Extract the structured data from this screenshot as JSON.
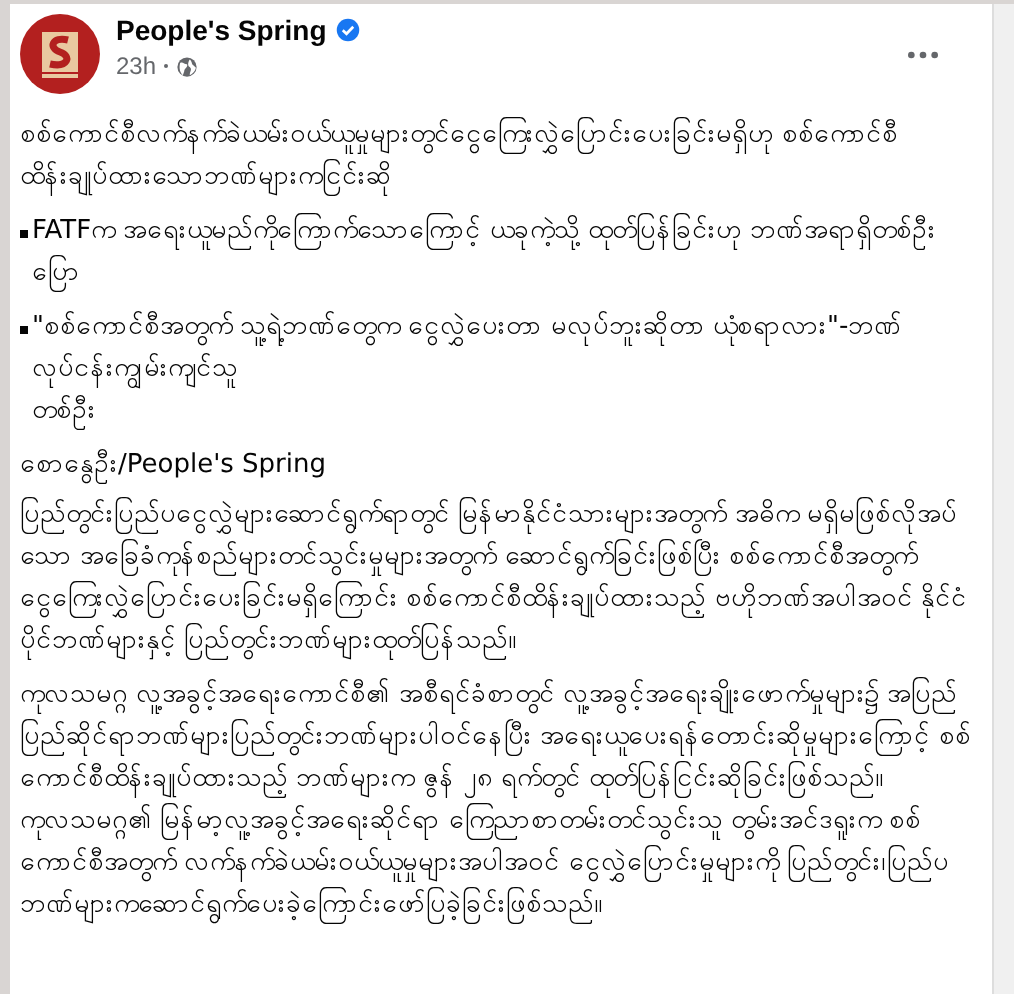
{
  "post": {
    "author": "People's Spring",
    "verified": true,
    "time": "23h",
    "paragraphs": [
      {
        "kind": "text",
        "text": "စစ်ကောင်စီလက်နက်ခဲယမ်းဝယ်ယူမှုများတွင်ငွေကြေးလွှဲပြောင်းပေးခြင်းမရှိဟု စစ်ကောင်စီထိန်းချုပ်ထားသောဘဏ်များကငြင်းဆို"
      },
      {
        "kind": "bullet",
        "text": "FATFက အရေးယူမည်ကိုကြောက်သောကြောင့် ယခုကဲ့သို့ ထုတ်ပြန်ခြင်းဟု ဘဏ်အရာရှိတစ်ဦးပြော"
      },
      {
        "kind": "bullet",
        "text": "\"စစ်ကောင်စီအတွက် သူ့ရဲ့ဘဏ်တွေက ငွေလွှဲပေးတာ မလုပ်ဘူးဆိုတာ ယုံစရာလား\"-ဘဏ်လုပ်ငန်းကျွမ်းကျင်သူ\nတစ်ဦး"
      },
      {
        "kind": "byline",
        "text": "စောနွေဦး/People's Spring"
      },
      {
        "kind": "text",
        "text": "ပြည်တွင်းပြည်ပငွေလွှဲများဆောင်ရွက်ရာတွင် မြန်မာနိုင်ငံသားများအတွက် အဓိက မရှိမဖြစ်လိုအပ်သော အခြေခံကုန်စည်များတင်သွင်းမှုများအတွက် ဆောင်ရွက်ခြင်းဖြစ်ပြီး စစ်ကောင်စီအတွက် ငွေကြေးလွှဲပြောင်းပေးခြင်းမရှိကြောင်း စစ်ကောင်စီထိန်းချုပ်ထားသည့် ဗဟိုဘဏ်အပါအဝင် နိုင်ငံပိုင်ဘဏ်များနှင့် ပြည်တွင်းဘဏ်များထုတ်ပြန်သည်။"
      },
      {
        "kind": "text",
        "text": "ကုလသမဂ္ဂ လူ့အခွင့်အရေးကောင်စီ၏ အစီရင်ခံစာတွင် လူ့အခွင့်အရေးချိုးဖောက်မှုများ၌ အပြည်ပြည်ဆိုင်ရာဘဏ်များပြည်တွင်းဘဏ်များပါဝင်နေပြီး အရေးယူပေးရန်တောင်းဆိုမှုများကြောင့် စစ်ကောင်စီထိန်းချုပ်ထားသည့် ဘဏ်များက ဇွန် ၂၈ ရက်တွင် ထုတ်ပြန်ငြင်းဆိုခြင်းဖြစ်သည်။ ကုလသမဂ္ဂ၏ မြန်မာ့လူ့အခွင့်အရေးဆိုင်ရာ ကြေညာစာတမ်းတင်သွင်းသူ တွမ်းအင်ဒရူးက စစ်ကောင်စီအတွက် လက်နက်ခဲယမ်းဝယ်ယူမှုများအပါအဝင် ငွေလွှဲပြောင်းမှုများကို ပြည်တွင်း၊ပြည်ပဘဏ်များကဆောင်ရွက်ပေးခဲ့ကြောင်းဖော်ပြခဲ့ခြင်းဖြစ်သည်။"
      }
    ]
  }
}
